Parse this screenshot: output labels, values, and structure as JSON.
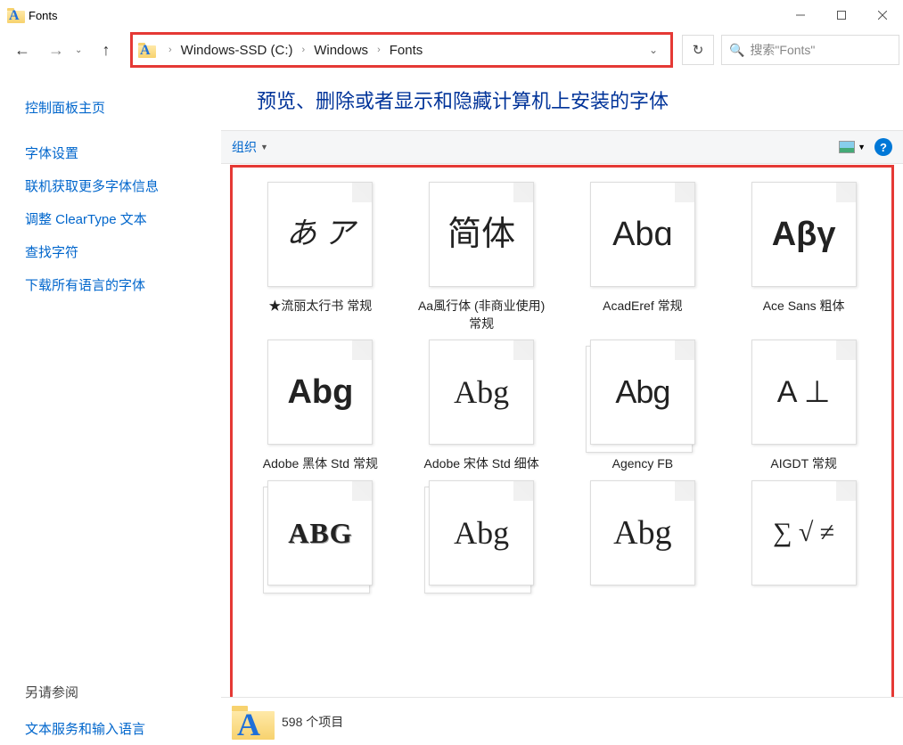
{
  "window": {
    "title": "Fonts"
  },
  "breadcrumb": {
    "items": [
      "Windows-SSD (C:)",
      "Windows",
      "Fonts"
    ]
  },
  "search": {
    "placeholder": "搜索\"Fonts\""
  },
  "sidebar": {
    "links": [
      "控制面板主页",
      "字体设置",
      "联机获取更多字体信息",
      "调整 ClearType 文本",
      "查找字符",
      "下载所有语言的字体"
    ],
    "see_also_title": "另请参阅",
    "see_also_links": [
      "文本服务和输入语言"
    ]
  },
  "content": {
    "heading": "预览、删除或者显示和隐藏计算机上安装的字体",
    "toolbar": {
      "organize": "组织"
    },
    "fonts": [
      {
        "name": "★流丽太行书 常规",
        "preview": "あ ア",
        "style": "font-family:'KaiTi',serif;font-style:italic;font-size:34px",
        "stack": false
      },
      {
        "name": "Aa風行体 (非商业使用) 常规",
        "preview": "简体",
        "style": "font-family:'STXingkai','KaiTi',cursive;font-size:38px",
        "stack": false
      },
      {
        "name": "AcadEref 常规",
        "preview": "Abɑ",
        "style": "font-family:Arial,sans-serif;font-size:38px",
        "stack": false
      },
      {
        "name": "Ace Sans 粗体",
        "preview": "Aβγ",
        "style": "font-family:Arial,sans-serif;font-weight:bold;font-size:38px",
        "stack": false
      },
      {
        "name": "Adobe 黑体 Std 常规",
        "preview": "Abg",
        "style": "font-family:'Microsoft YaHei',sans-serif;font-weight:bold;font-size:38px",
        "stack": false
      },
      {
        "name": "Adobe 宋体 Std 细体",
        "preview": "Abg",
        "style": "font-family:'SimSun',serif;font-size:36px;font-weight:300",
        "stack": false
      },
      {
        "name": "Agency FB",
        "preview": "Abg",
        "style": "font-family:'Arial Narrow',sans-serif;font-size:36px;letter-spacing:-1px",
        "stack": true
      },
      {
        "name": "AIGDT 常规",
        "preview": "A ⊥",
        "style": "font-family:Arial,sans-serif;font-size:34px",
        "stack": false
      },
      {
        "name": "",
        "preview": "ABG",
        "style": "font-family:'Times New Roman',serif;font-weight:bold;font-size:32px;letter-spacing:1px;text-shadow:1px 1px 0 #999",
        "stack": true
      },
      {
        "name": "",
        "preview": "Abg",
        "style": "font-family:Georgia,serif;font-size:36px",
        "stack": true
      },
      {
        "name": "",
        "preview": "Abg",
        "style": "font-family:'Brush Script MT',cursive;font-size:38px",
        "stack": false
      },
      {
        "name": "",
        "preview": "∑ √ ≠",
        "style": "font-family:'Cambria Math',serif;font-size:30px",
        "stack": false
      }
    ],
    "status": "598 个项目"
  }
}
